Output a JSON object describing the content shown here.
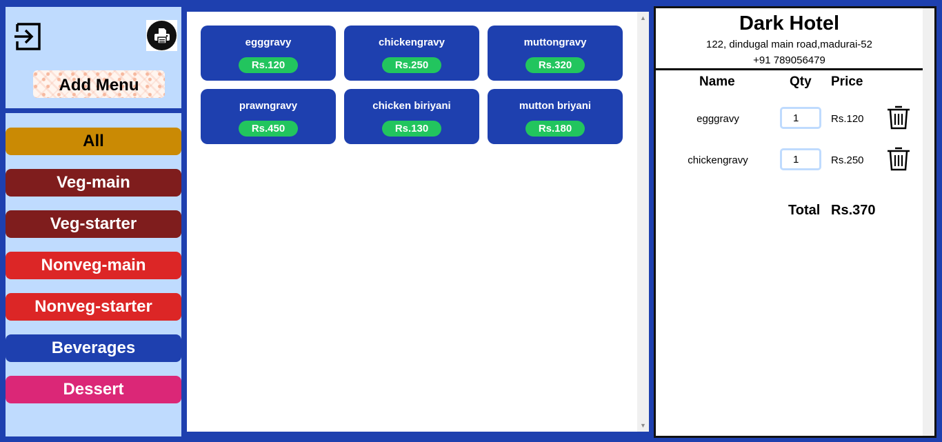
{
  "sidebar": {
    "add_menu_label": "Add Menu",
    "categories": [
      {
        "label": "All",
        "bg": "#ca8a04",
        "color": "#000000"
      },
      {
        "label": "Veg-main",
        "bg": "#7f1d1d",
        "color": "#ffffff"
      },
      {
        "label": "Veg-starter",
        "bg": "#7f1d1d",
        "color": "#ffffff"
      },
      {
        "label": "Nonveg-main",
        "bg": "#dc2626",
        "color": "#ffffff"
      },
      {
        "label": "Nonveg-starter",
        "bg": "#dc2626",
        "color": "#ffffff"
      },
      {
        "label": "Beverages",
        "bg": "#1e40af",
        "color": "#ffffff"
      },
      {
        "label": "Dessert",
        "bg": "#db2777",
        "color": "#ffffff"
      }
    ]
  },
  "menu": {
    "items": [
      {
        "name": "egggravy",
        "price": "Rs.120"
      },
      {
        "name": "chickengravy",
        "price": "Rs.250"
      },
      {
        "name": "muttongravy",
        "price": "Rs.320"
      },
      {
        "name": "prawngravy",
        "price": "Rs.450"
      },
      {
        "name": "chicken biriyani",
        "price": "Rs.130"
      },
      {
        "name": "mutton briyani",
        "price": "Rs.180"
      }
    ]
  },
  "bill": {
    "hotel_name": "Dark Hotel",
    "address": "122, dindugal main road,madurai-52",
    "phone": "+91 789056479",
    "headers": {
      "name": "Name",
      "qty": "Qty",
      "price": "Price"
    },
    "orders": [
      {
        "name": "egggravy",
        "qty": "1",
        "price": "Rs.120"
      },
      {
        "name": "chickengravy",
        "qty": "1",
        "price": "Rs.250"
      }
    ],
    "total_label": "Total",
    "total_value": "Rs.370"
  },
  "colors": {
    "frame": "#1e40af",
    "sidebar_bg": "#bfdbfe",
    "card_bg": "#1e40af",
    "price_pill": "#22c55e"
  },
  "icons": {
    "logout": "logout-icon",
    "print": "printer-icon",
    "delete": "trash-icon"
  }
}
